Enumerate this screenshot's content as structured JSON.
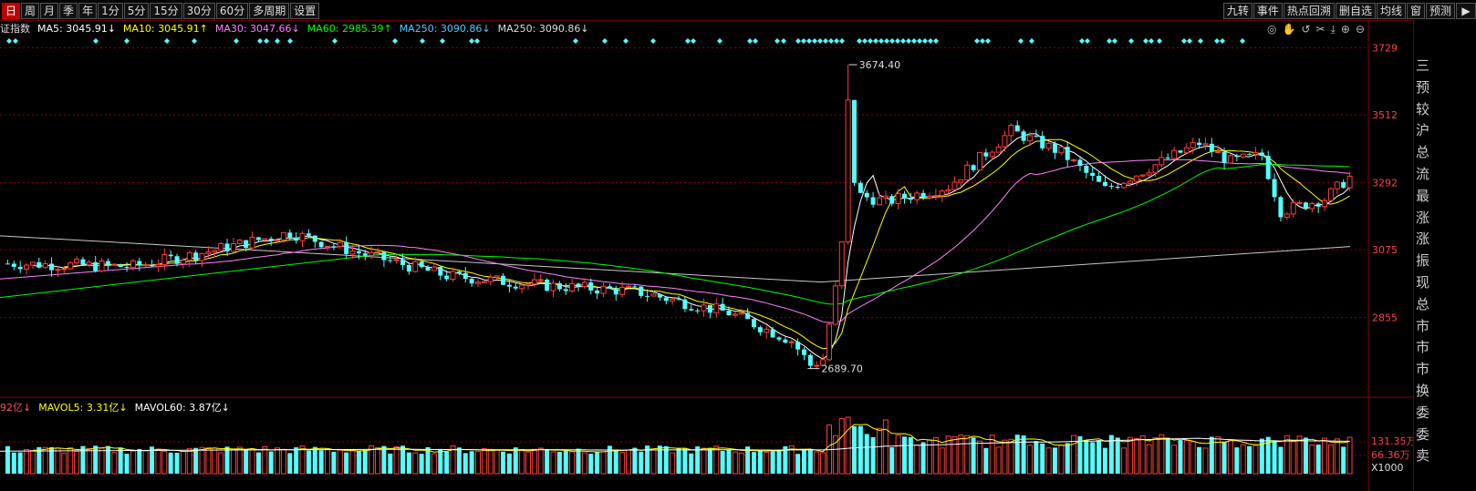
{
  "toolbar": {
    "tabs": [
      "日",
      "周",
      "月",
      "季",
      "年",
      "1分",
      "5分",
      "15分",
      "30分",
      "60分",
      "多周期",
      "设置"
    ],
    "active_tab": "日",
    "right_tools": [
      "九转",
      "事件",
      "热点回溯",
      "删自选",
      "均线",
      "窗",
      "预测"
    ]
  },
  "indicator_line": {
    "name": "证指数",
    "ma5": "MA5: 3045.91↓",
    "ma10": "MA10: 3045.91↑",
    "ma30": "MA30: 3047.66↓",
    "ma60": "MA60: 2985.39↑",
    "ma250a": "MA250: 3090.86↓",
    "ma250b": "MA250: 3090.86↓"
  },
  "volume_line": {
    "vol": "92亿↓",
    "mavol5": "MAVOL5: 3.31亿↓",
    "mavol60": "MAVOL60: 3.87亿↓"
  },
  "price_axis": [
    "3729",
    "3512",
    "3292",
    "3075",
    "2855"
  ],
  "volume_axis": [
    "131.35万",
    "66.36万",
    "X1000"
  ],
  "annotations": {
    "high": "3674.40",
    "low": "2689.70"
  },
  "side_panel_chars": [
    "三",
    "预",
    "较",
    "沪",
    "总",
    "流",
    "最",
    "涨",
    "涨",
    "振",
    "现",
    "总",
    "市",
    "市",
    "市",
    "换",
    "委",
    "委",
    "卖"
  ],
  "colors": {
    "up": "#ff3c3c",
    "down": "#54ffff",
    "ma5": "#ffffff",
    "ma10": "#ffff00",
    "ma30": "#ff80ff",
    "ma60": "#00ff00",
    "ma250": "#c8c8c8",
    "grid": "#8b0000",
    "diamond": "#54ffff"
  },
  "chart_data": {
    "type": "candlestick",
    "y_range": [
      2600,
      3760
    ],
    "y_ticks": [
      3729,
      3512,
      3292,
      3075,
      2855
    ],
    "series": [
      {
        "name": "MA5",
        "color": "#ffffff"
      },
      {
        "name": "MA10",
        "color": "#ffff00"
      },
      {
        "name": "MA30",
        "color": "#ff80ff"
      },
      {
        "name": "MA60",
        "color": "#00ff00"
      },
      {
        "name": "MA250",
        "color": "#c8c8c8"
      }
    ],
    "high_annotation": 3674.4,
    "low_annotation": 2689.7,
    "volume_ticks": [
      "131.35万",
      "66.36万"
    ]
  }
}
